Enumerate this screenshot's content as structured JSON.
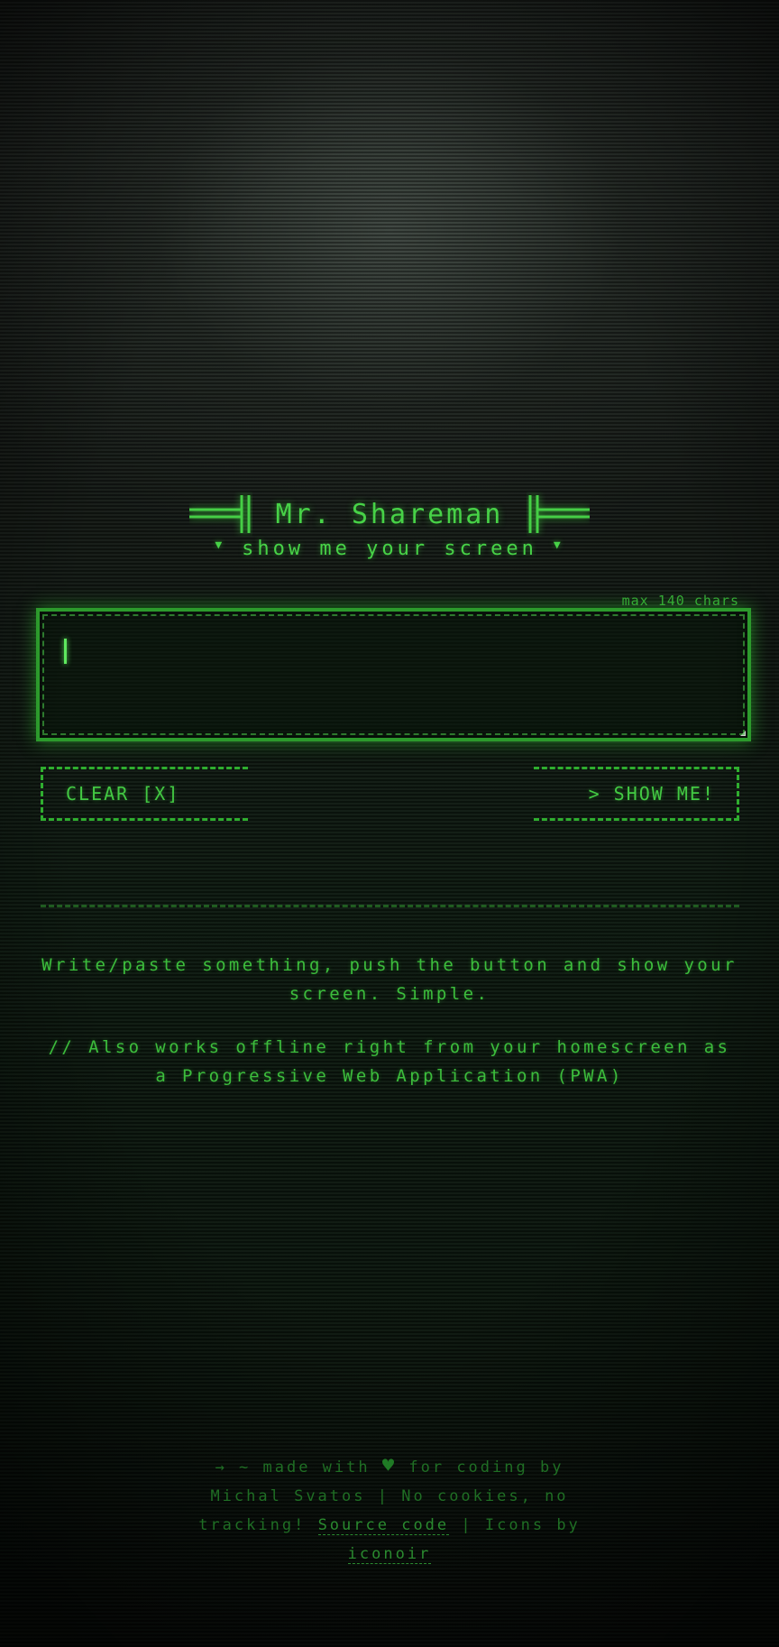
{
  "header": {
    "title": "Mr. Shareman",
    "tagline": "show me your screen",
    "tagline_marker": "▼"
  },
  "editor": {
    "max_chars_label": "max 140 chars",
    "value": "",
    "placeholder": ""
  },
  "buttons": {
    "clear_label": "CLEAR [X]",
    "show_label": "> SHOW ME!"
  },
  "description": {
    "line1": "Write/paste something, push the button and show your screen. Simple.",
    "line2": "// Also works offline right from your homescreen as a Progressive Web Application (PWA)"
  },
  "footer": {
    "prefix": "→ ~ made with",
    "heart": "♥",
    "made_for": "for coding by",
    "author": "Michal Svatos",
    "separator": "|",
    "privacy": "No cookies, no tracking!",
    "source_link": "Source code",
    "icons_by": "Icons by",
    "icons_link": "iconoir"
  },
  "colors": {
    "accent": "#3fc13f",
    "glow": "#5ee85e",
    "footer": "#1f6e24"
  }
}
